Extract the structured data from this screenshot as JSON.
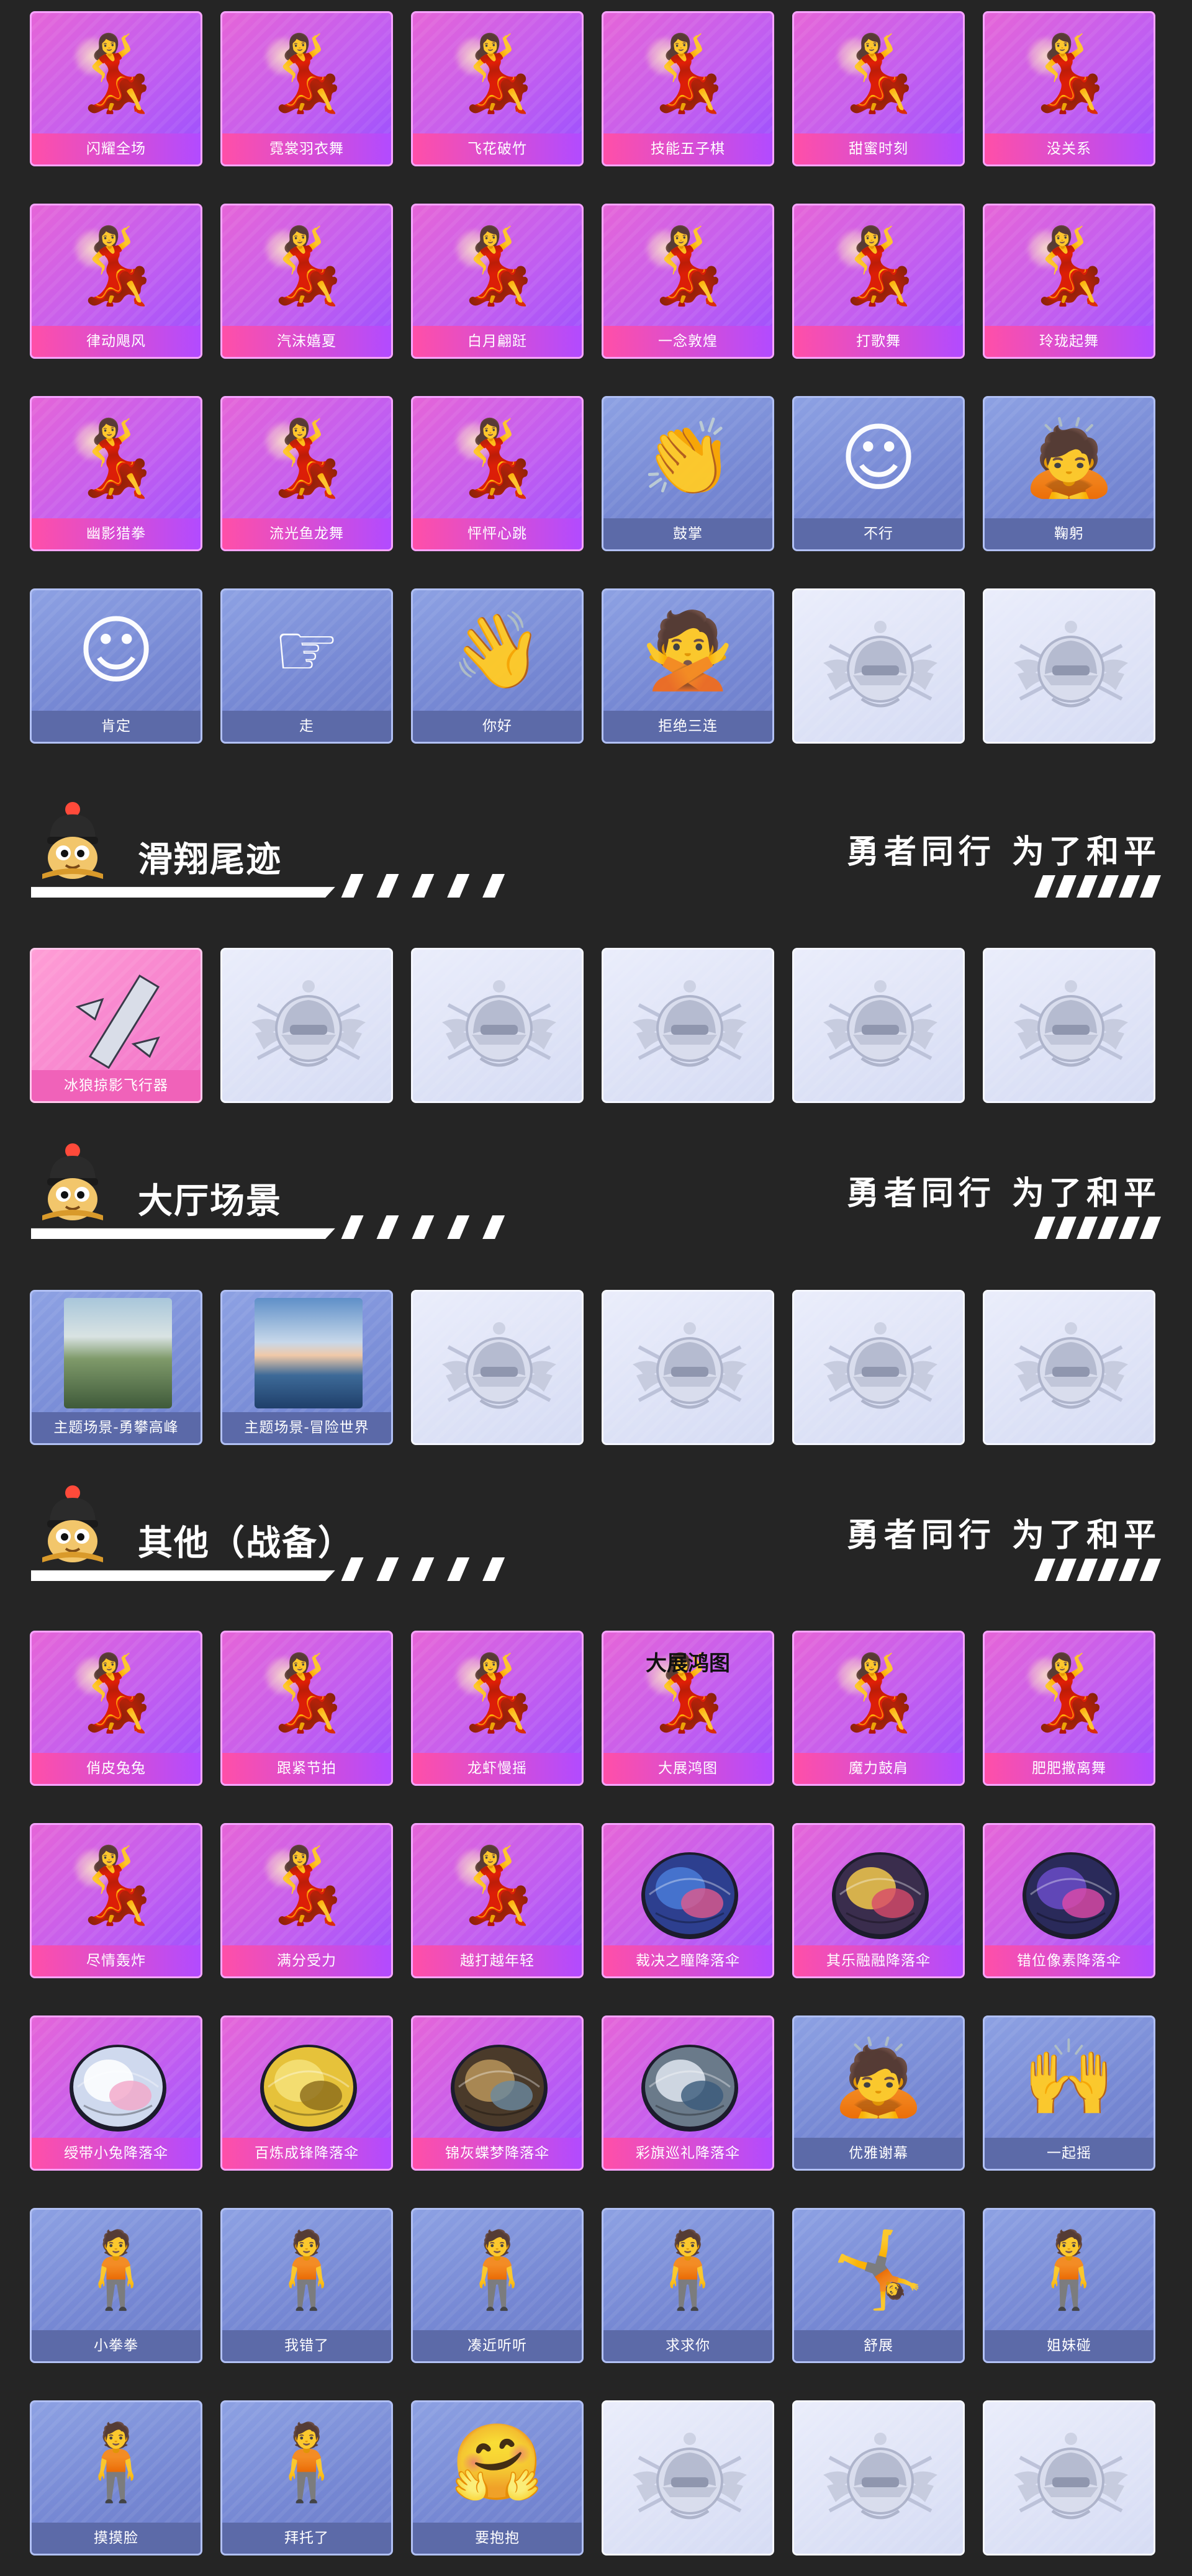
{
  "slogan": "勇者同行 为了和平",
  "colors": {
    "page_bg": "#252525",
    "premium_card": "#c25ef0",
    "premium_label": "#ff4fa8",
    "basic_card": "#7587d3",
    "basic_label": "#5c6aa8",
    "locked_card": "#e3e7f8",
    "trail_card": "#f06fc7"
  },
  "sections": [
    {
      "title": "",
      "rows": [
        [
          {
            "label": "闪耀全场",
            "type": "premium",
            "icon": "dance-pose-icon"
          },
          {
            "label": "霓裳羽衣舞",
            "type": "premium",
            "icon": "dance-pose-icon"
          },
          {
            "label": "飞花破竹",
            "type": "premium",
            "icon": "dance-pose-icon"
          },
          {
            "label": "技能五子棋",
            "type": "premium",
            "icon": "dance-pose-icon"
          },
          {
            "label": "甜蜜时刻",
            "type": "premium",
            "icon": "dance-pose-icon"
          },
          {
            "label": "没关系",
            "type": "premium",
            "icon": "dance-pose-icon"
          }
        ],
        [
          {
            "label": "律动飓风",
            "type": "premium",
            "icon": "dance-pose-icon"
          },
          {
            "label": "汽沫嬉夏",
            "type": "premium",
            "icon": "dance-pose-icon"
          },
          {
            "label": "白月翩跹",
            "type": "premium",
            "icon": "dance-pose-icon"
          },
          {
            "label": "一念敦煌",
            "type": "premium",
            "icon": "dance-pose-icon"
          },
          {
            "label": "打歌舞",
            "type": "premium",
            "icon": "dance-pose-icon"
          },
          {
            "label": "玲珑起舞",
            "type": "premium",
            "icon": "dance-pose-icon"
          }
        ],
        [
          {
            "label": "幽影猎拳",
            "type": "premium",
            "icon": "dance-pose-icon"
          },
          {
            "label": "流光鱼龙舞",
            "type": "premium",
            "icon": "dance-pose-icon"
          },
          {
            "label": "怦怦心跳",
            "type": "premium",
            "icon": "dance-pose-icon"
          },
          {
            "label": "鼓掌",
            "type": "basic",
            "icon": "clap-hands-icon"
          },
          {
            "label": "不行",
            "type": "basic",
            "icon": "shake-head-icon"
          },
          {
            "label": "鞠躬",
            "type": "basic",
            "icon": "bow-pose-icon"
          }
        ],
        [
          {
            "label": "肯定",
            "type": "basic",
            "icon": "nod-head-icon"
          },
          {
            "label": "走",
            "type": "basic",
            "icon": "pointing-hand-icon"
          },
          {
            "label": "你好",
            "type": "basic",
            "icon": "wave-hand-icon"
          },
          {
            "label": "拒绝三连",
            "type": "basic",
            "icon": "arms-crossed-icon"
          },
          {
            "label": "",
            "type": "locked",
            "icon": "helmet-emblem-icon"
          },
          {
            "label": "",
            "type": "locked",
            "icon": "helmet-emblem-icon"
          }
        ]
      ]
    },
    {
      "title": "滑翔尾迹",
      "rows": [
        [
          {
            "label": "冰狼掠影飞行器",
            "type": "trail",
            "icon": "glider-trail-icon"
          },
          {
            "label": "",
            "type": "locked",
            "icon": "helmet-emblem-icon"
          },
          {
            "label": "",
            "type": "locked",
            "icon": "helmet-emblem-icon"
          },
          {
            "label": "",
            "type": "locked",
            "icon": "helmet-emblem-icon"
          },
          {
            "label": "",
            "type": "locked",
            "icon": "helmet-emblem-icon"
          },
          {
            "label": "",
            "type": "locked",
            "icon": "helmet-emblem-icon"
          }
        ]
      ]
    },
    {
      "title": "大厅场景",
      "rows": [
        [
          {
            "label": "主题场景-勇攀高峰",
            "type": "scene",
            "icon": "mountain-scene-icon"
          },
          {
            "label": "主题场景-冒险世界",
            "type": "scene",
            "icon": "ocean-scene-icon"
          },
          {
            "label": "",
            "type": "locked",
            "icon": "helmet-emblem-icon"
          },
          {
            "label": "",
            "type": "locked",
            "icon": "helmet-emblem-icon"
          },
          {
            "label": "",
            "type": "locked",
            "icon": "helmet-emblem-icon"
          },
          {
            "label": "",
            "type": "locked",
            "icon": "helmet-emblem-icon"
          }
        ]
      ]
    },
    {
      "title": "其他（战备）",
      "rows": [
        [
          {
            "label": "俏皮兔兔",
            "type": "premium",
            "icon": "dance-pose-icon"
          },
          {
            "label": "跟紧节拍",
            "type": "premium",
            "icon": "dance-pose-icon"
          },
          {
            "label": "龙虾慢摇",
            "type": "premium",
            "icon": "dance-pose-icon"
          },
          {
            "label": "大展鸿图",
            "type": "premium",
            "icon": "dance-pose-icon",
            "badge": "大展鸿图"
          },
          {
            "label": "魔力鼓肩",
            "type": "premium",
            "icon": "dance-pose-icon"
          },
          {
            "label": "肥肥撒离舞",
            "type": "premium",
            "icon": "dance-pose-icon"
          }
        ],
        [
          {
            "label": "尽情轰炸",
            "type": "premium",
            "icon": "dance-pose-icon"
          },
          {
            "label": "满分受力",
            "type": "premium",
            "icon": "dance-pose-icon"
          },
          {
            "label": "越打越年轻",
            "type": "premium",
            "icon": "dance-pose-icon"
          },
          {
            "label": "裁决之瞳降落伞",
            "type": "premium",
            "icon": "parachute-icon"
          },
          {
            "label": "其乐融融降落伞",
            "type": "premium",
            "icon": "parachute-icon"
          },
          {
            "label": "错位像素降落伞",
            "type": "premium",
            "icon": "parachute-icon"
          }
        ],
        [
          {
            "label": "绶带小兔降落伞",
            "type": "premium",
            "icon": "parachute-icon"
          },
          {
            "label": "百炼成锋降落伞",
            "type": "premium",
            "icon": "parachute-icon"
          },
          {
            "label": "锦灰蝶梦降落伞",
            "type": "premium",
            "icon": "parachute-icon"
          },
          {
            "label": "彩旗巡礼降落伞",
            "type": "premium",
            "icon": "parachute-icon"
          },
          {
            "label": "优雅谢幕",
            "type": "basic",
            "icon": "bow-pose-icon"
          },
          {
            "label": "一起摇",
            "type": "basic",
            "icon": "arms-up-icon"
          }
        ],
        [
          {
            "label": "小拳拳",
            "type": "basic",
            "icon": "idle-pose-icon"
          },
          {
            "label": "我错了",
            "type": "basic",
            "icon": "idle-pose-icon"
          },
          {
            "label": "凑近听听",
            "type": "basic",
            "icon": "idle-pose-icon"
          },
          {
            "label": "求求你",
            "type": "basic",
            "icon": "idle-pose-icon"
          },
          {
            "label": "舒展",
            "type": "basic",
            "icon": "stretch-pose-icon"
          },
          {
            "label": "姐妹碰",
            "type": "basic",
            "icon": "idle-pose-icon"
          }
        ],
        [
          {
            "label": "摸摸脸",
            "type": "basic",
            "icon": "idle-pose-icon"
          },
          {
            "label": "拜托了",
            "type": "basic",
            "icon": "idle-pose-icon"
          },
          {
            "label": "要抱抱",
            "type": "basic",
            "icon": "arms-open-icon"
          },
          {
            "label": "",
            "type": "locked",
            "icon": "helmet-emblem-icon"
          },
          {
            "label": "",
            "type": "locked",
            "icon": "helmet-emblem-icon"
          },
          {
            "label": "",
            "type": "locked",
            "icon": "helmet-emblem-icon"
          }
        ]
      ]
    }
  ]
}
